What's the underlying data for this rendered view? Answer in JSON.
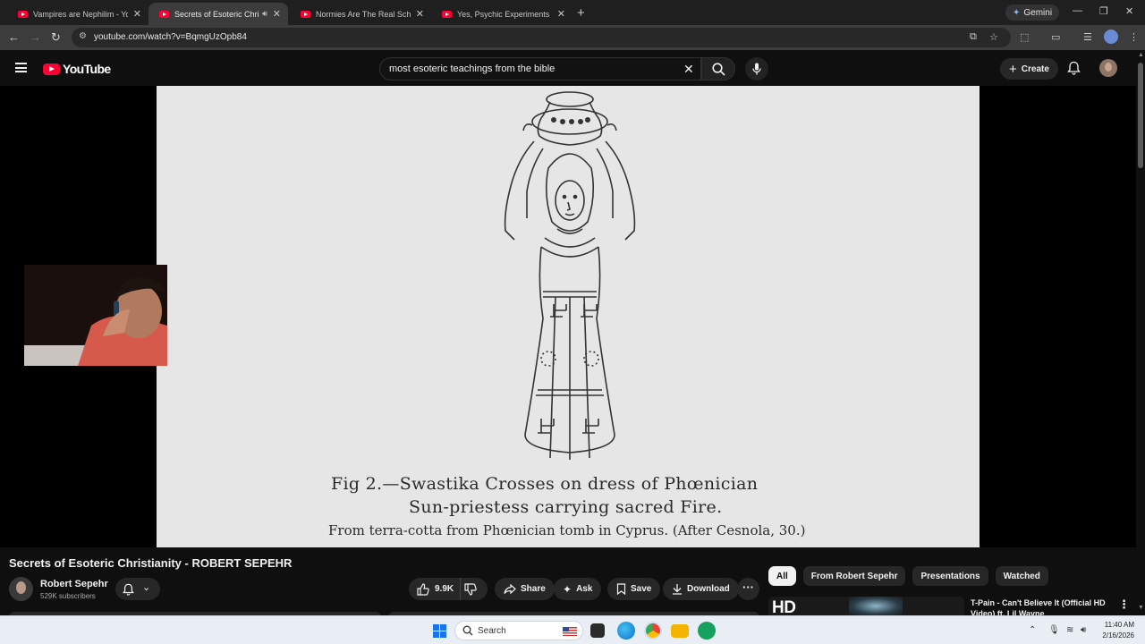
{
  "browser": {
    "tabs": [
      {
        "title": "Vampires are Nephilim - YouTu",
        "active": false
      },
      {
        "title": "Secrets of Esoteric Christian",
        "active": true
      },
      {
        "title": "Normies Are The Real Schizos",
        "active": false
      },
      {
        "title": "Yes, Psychic Experiments Still H",
        "active": false
      }
    ],
    "gemini_label": "Gemini",
    "url": "youtube.com/watch?v=BqmgUzOpb84"
  },
  "youtube": {
    "logo_text": "YouTube",
    "search_query": "most esoteric teachings from the bible",
    "create_label": "Create"
  },
  "video": {
    "caption_line1": "Fig 2.—Swastika Crosses on dress of Phœnician",
    "caption_line2": "Sun-priestess carrying sacred Fire.",
    "caption_line3": "From terra-cotta from Phœnician tomb in Cyprus.   (After Cesnola, 30.)",
    "title": "Secrets of Esoteric Christianity - ROBERT SEPEHR",
    "channel_name": "Robert Sepehr",
    "subscribers": "529K subscribers",
    "likes": "9.9K",
    "share_label": "Share",
    "ask_label": "Ask",
    "save_label": "Save",
    "download_label": "Download"
  },
  "sidebar": {
    "chips": [
      "All",
      "From Robert Sepehr",
      "Presentations",
      "Watched"
    ],
    "first_rec": {
      "thumb_text": "HD",
      "title": "T-Pain - Can't Believe It (Official HD Video) ft. Lil Wayne"
    }
  },
  "taskbar": {
    "search_label": "Search",
    "time": "11:40 AM",
    "date": "2/16/2026"
  },
  "colors": {
    "youtube_red": "#ff0033",
    "page_bg": "#0f0f0f",
    "pill_bg": "#272727",
    "taskbar_bg": "#e9eef4"
  }
}
